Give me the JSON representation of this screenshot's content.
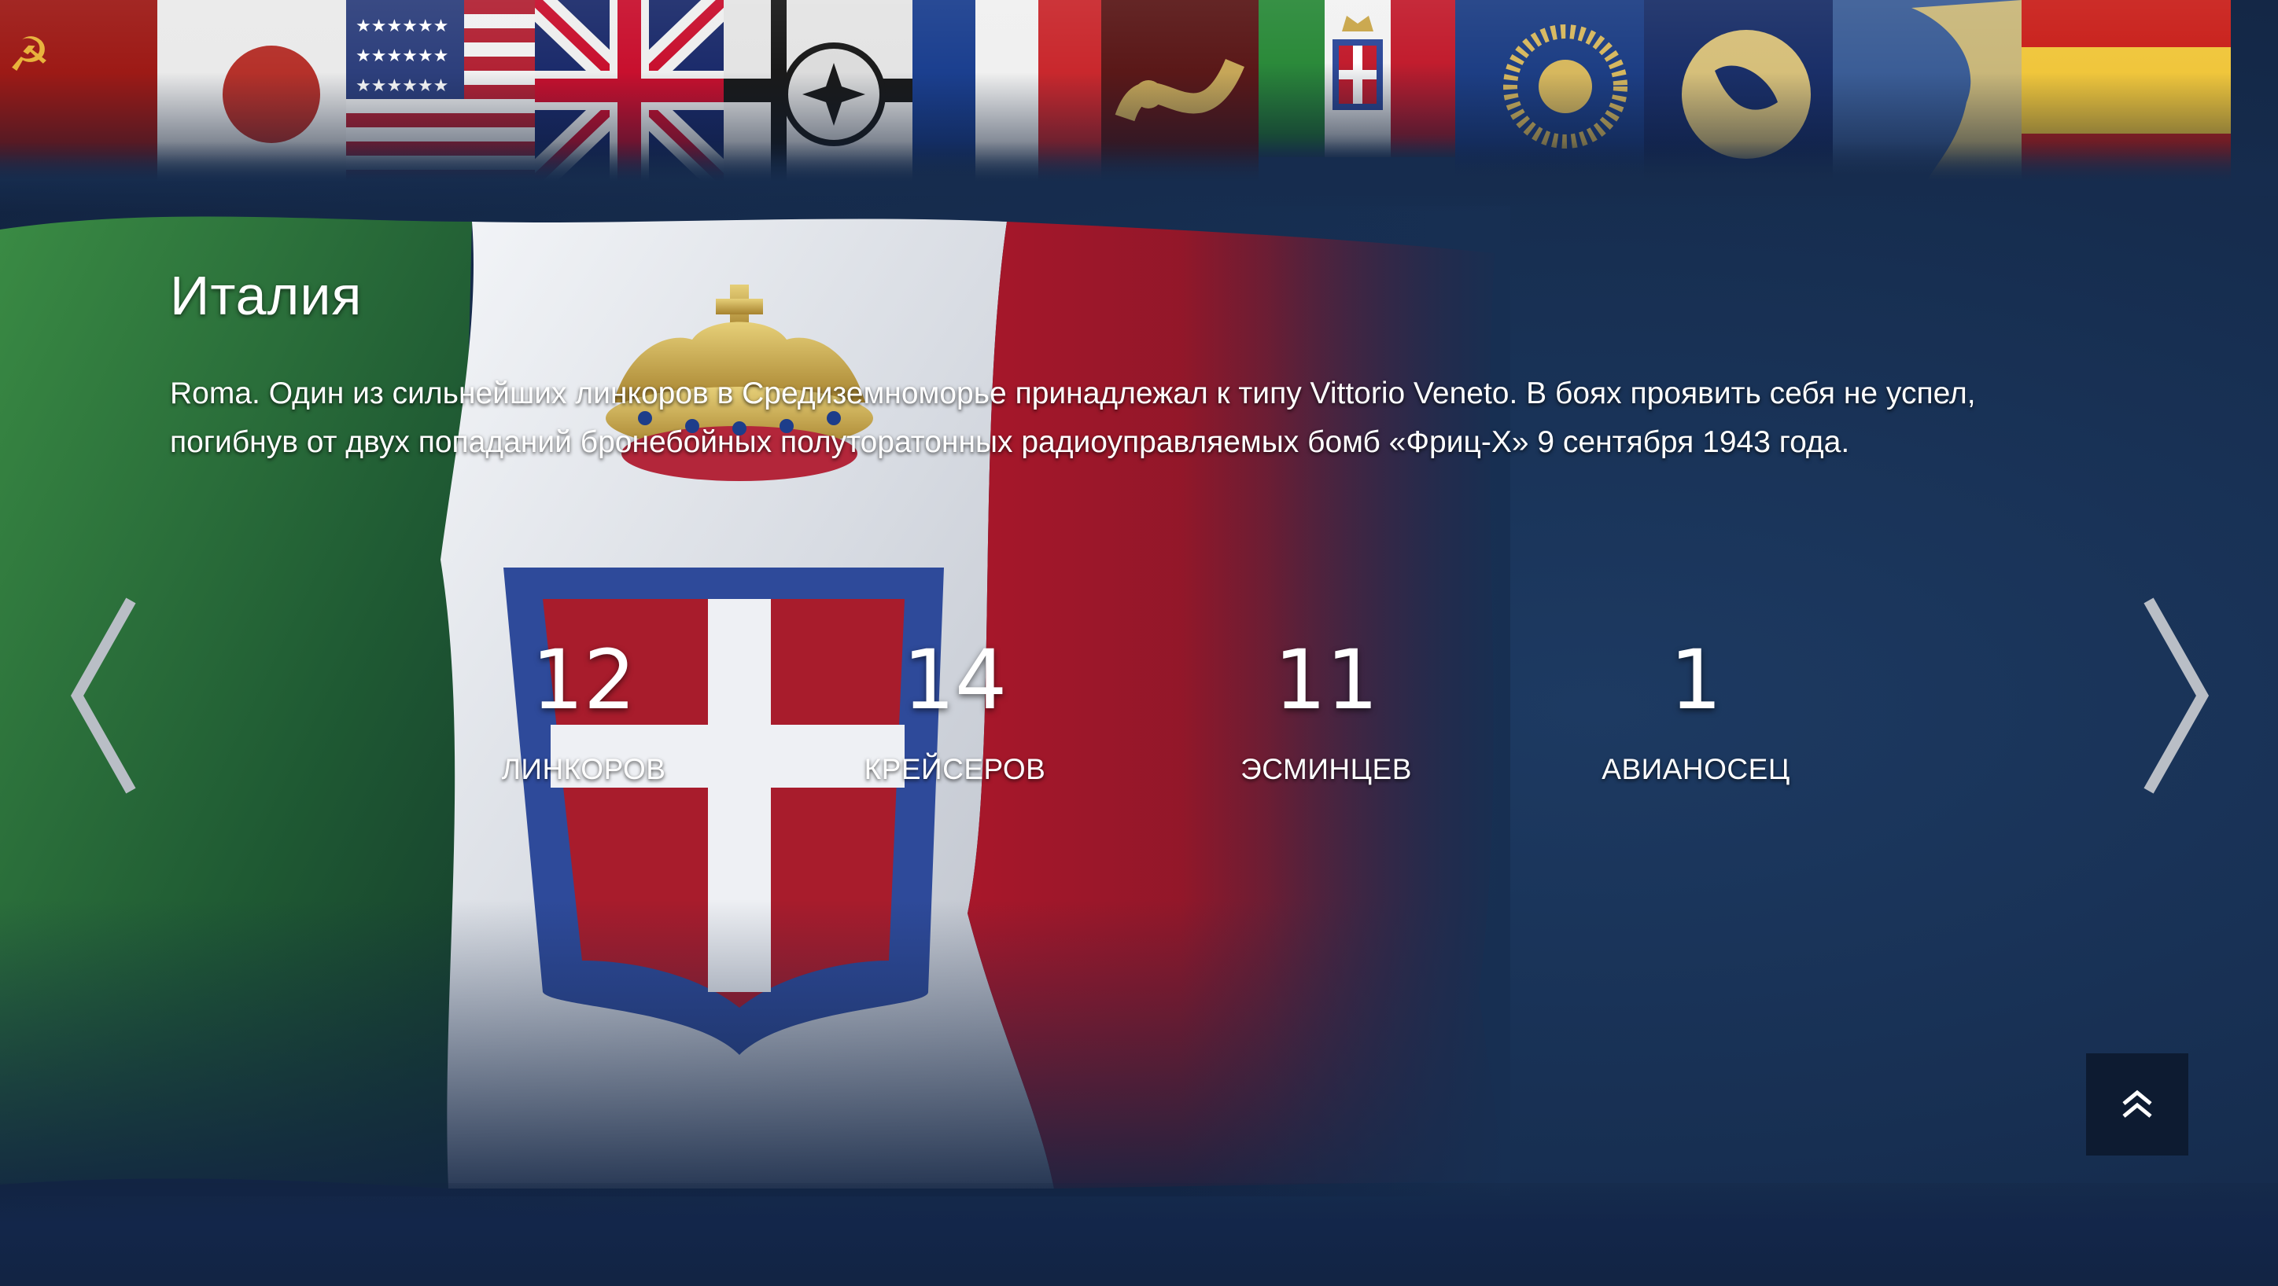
{
  "flags": [
    {
      "name": "ussr-flag-icon",
      "base": "#9d1a16"
    },
    {
      "name": "japan-flag-icon",
      "base": "#ececec"
    },
    {
      "name": "usa-flag-icon",
      "base": "#b22234"
    },
    {
      "name": "uk-flag-icon",
      "base": "#1b2b6b"
    },
    {
      "name": "germany-flag-icon",
      "base": "#e5e5e5"
    },
    {
      "name": "france-flag-icon",
      "base": "#1b3f8f"
    },
    {
      "name": "pan-asia-flag-icon",
      "base": "#5a1818"
    },
    {
      "name": "italy-flag-icon",
      "base": "#f2f2f2"
    },
    {
      "name": "commonwealth-flag-icon",
      "base": "#1d3e84"
    },
    {
      "name": "europe-flag-icon",
      "base": "#1a2f68"
    },
    {
      "name": "pan-america-flag-icon",
      "base": "#3b5d96"
    },
    {
      "name": "spain-flag-icon",
      "base": "#c9201b"
    }
  ],
  "nation": {
    "title": "Италия",
    "description": "Roma. Один из сильнейших линкоров в Средиземноморье принадлежал к типу Vittorio Veneto. В боях проявить себя не успел, погибнув от двух попаданий бронебойных полуторатонных радиоуправляемых бомб «Фриц-Х» 9 сентября 1943 года."
  },
  "stats": [
    {
      "value": "12",
      "label": "ЛИНКОРОВ"
    },
    {
      "value": "14",
      "label": "КРЕЙСЕРОВ"
    },
    {
      "value": "11",
      "label": "ЭСМИНЦЕВ"
    },
    {
      "value": "1",
      "label": "АВИАНОСЕЦ"
    }
  ],
  "colors": {
    "background": "#172f52",
    "italy_green": "#2b7a3a",
    "italy_white": "#e9edf2",
    "italy_red": "#a51b2a",
    "savoy_blue": "#2e4a9a",
    "crown_gold": "#c9a64a"
  },
  "icons": {
    "prev": "chevron-left-icon",
    "next": "chevron-right-icon",
    "scroll_top": "double-chevron-up-icon"
  }
}
